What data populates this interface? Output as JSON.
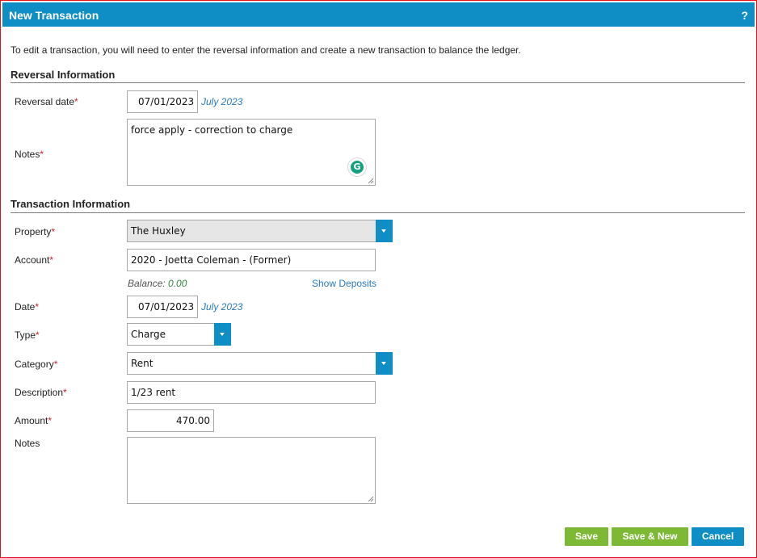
{
  "dialog": {
    "title": "New Transaction",
    "help": "?"
  },
  "intro": "To edit a transaction, you will need to enter the reversal information and create a new transaction to balance the ledger.",
  "reversal": {
    "section_title": "Reversal Information",
    "date_label": "Reversal date",
    "date_value": "07/01/2023",
    "date_month": "July 2023",
    "notes_label": "Notes",
    "notes_value": "force apply - correction to charge",
    "grammarly_icon_text": "G"
  },
  "transaction": {
    "section_title": "Transaction Information",
    "property_label": "Property",
    "property_value": "The Huxley",
    "account_label": "Account",
    "account_value": "2020 - Joetta Coleman - (Former)",
    "balance_label": "Balance:",
    "balance_value": "0.00",
    "show_deposits": "Show Deposits",
    "date_label": "Date",
    "date_value": "07/01/2023",
    "date_month": "July 2023",
    "type_label": "Type",
    "type_value": "Charge",
    "category_label": "Category",
    "category_value": "Rent",
    "description_label": "Description",
    "description_value": "1/23 rent",
    "amount_label": "Amount",
    "amount_value": "470.00",
    "notes_label": "Notes",
    "notes_value": ""
  },
  "required_marker": "*",
  "buttons": {
    "save": "Save",
    "save_new": "Save & New",
    "cancel": "Cancel"
  },
  "colors": {
    "accent": "#0f8ec5",
    "save_green": "#7db935",
    "required": "#d0212b",
    "border_red": "#e8101a"
  }
}
